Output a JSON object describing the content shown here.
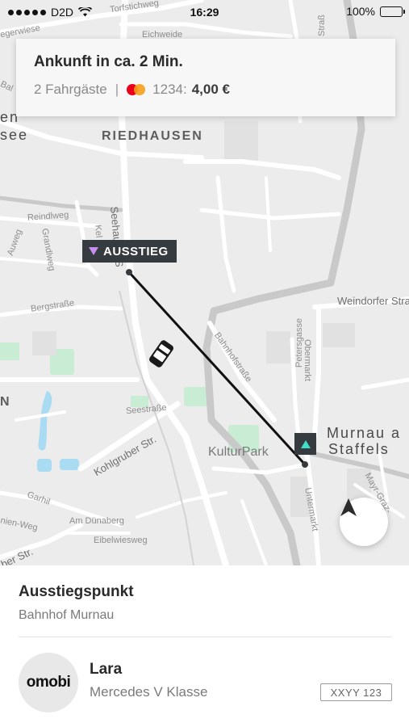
{
  "status_bar": {
    "carrier": "D2D",
    "time": "16:29",
    "battery": "100%"
  },
  "arrival_card": {
    "title": "Ankunft in ca. 2 Min.",
    "passengers": "2 Fahrgäste",
    "separator": "|",
    "card_last4": "1234:",
    "price": "4,00 €"
  },
  "map": {
    "labels": {
      "torfstichweg": "Torfstichweg",
      "eichweide": "Eichweide",
      "strasse_top": "Straß",
      "egerwiese": "egerwiese",
      "bal": "Bal",
      "en": "en",
      "see": "see",
      "riedhausen": "RIEDHAUSEN",
      "seehauser": "Seehauser S",
      "reindlweg": "Reindlweg",
      "grandlweg": "Grandlweg",
      "aweg": "Auweg",
      "kel": "Kel",
      "bergstrasse": "Bergstraße",
      "weindorfer": "Weindorfer Stra",
      "bahnhofstrasse": "Bahnhofstraße",
      "obermarkt": "Obermarkt",
      "petersgasse": "Petersgasse",
      "n_left": "N",
      "seestrasse": "Seestraße",
      "kohlgruber": "Kohlgruber Str.",
      "kulturpark": "KulturPark",
      "murnau_1": "Murnau a",
      "murnau_2": "Staffels",
      "mayr_graz": "Mayr-Graz-",
      "untermarkt": "Untermarkt",
      "garhil": "Garhil",
      "am_dunaberg": "Am Dünaberg",
      "nien_weg": "nien-Weg",
      "eibelwiesweg": "Eibelwiesweg",
      "ber_str": "ber Str."
    },
    "dropoff_label": "AUSSTIEG",
    "dropoff_color": "#c58ef0",
    "pickup_color": "#3fe0c5",
    "park_color": "#c9ecd5",
    "water_color": "#a9dcf3",
    "route_color": "#111111"
  },
  "sheet": {
    "dest_title": "Ausstiegspunkt",
    "dest_name": "Bahnhof Murnau",
    "driver_name": "Lara",
    "vehicle": "Mercedes V Klasse",
    "plate": "XXYY 123",
    "logo_text": "omobi"
  }
}
